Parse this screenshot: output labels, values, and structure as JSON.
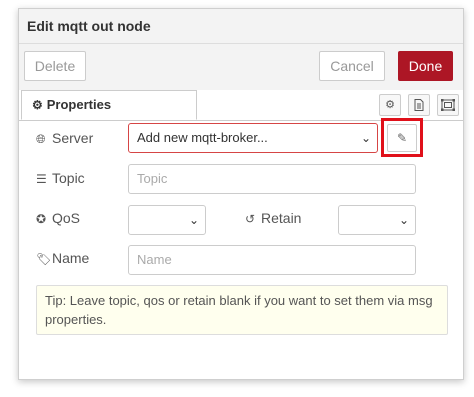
{
  "dialog": {
    "title": "Edit mqtt out node"
  },
  "toolbar": {
    "delete_label": "Delete",
    "cancel_label": "Cancel",
    "done_label": "Done"
  },
  "tabs": {
    "properties_label": "Properties",
    "icons": [
      "gear-icon",
      "description-icon",
      "appearance-icon"
    ]
  },
  "form": {
    "server": {
      "label": "Server",
      "icon": "globe-icon",
      "selected": "Add new mqtt-broker...",
      "edit_icon": "pencil-icon"
    },
    "topic": {
      "label": "Topic",
      "icon": "tasks-icon",
      "value": "",
      "placeholder": "Topic"
    },
    "qos": {
      "label": "QoS",
      "icon": "empire-icon",
      "selected": ""
    },
    "retain": {
      "label": "Retain",
      "icon": "history-icon",
      "selected": ""
    },
    "name": {
      "label": "Name",
      "icon": "tag-icon",
      "value": "",
      "placeholder": "Name"
    }
  },
  "tip": {
    "text": "Tip: Leave topic, qos or retain blank if you want to set them via msg properties."
  },
  "colors": {
    "done_button": "#ad1625",
    "highlight": "#e0101a",
    "tip_background": "#ffffee"
  }
}
